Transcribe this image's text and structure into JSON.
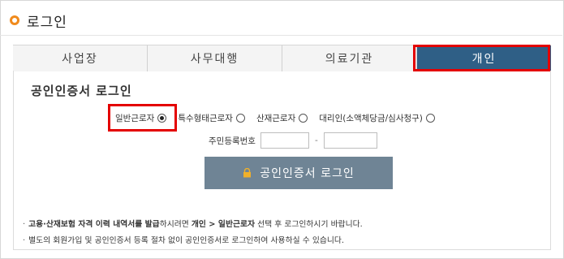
{
  "header": {
    "title": "로그인"
  },
  "tabs": [
    {
      "label": "사업장",
      "active": false
    },
    {
      "label": "사무대행",
      "active": false
    },
    {
      "label": "의료기관",
      "active": false
    },
    {
      "label": "개인",
      "active": true
    }
  ],
  "section": {
    "title": "공인인증서 로그인"
  },
  "radios": [
    {
      "label": "일반근로자",
      "checked": true
    },
    {
      "label": "특수형태근로자",
      "checked": false
    },
    {
      "label": "산재근로자",
      "checked": false
    },
    {
      "label": "대리인(소액체당금/심사청구)",
      "checked": false
    }
  ],
  "id_field": {
    "label": "주민등록번호",
    "first_value": "",
    "second_value": "",
    "separator": "-"
  },
  "login_button": {
    "label": "공인인증서 로그인",
    "icon": "lock-icon"
  },
  "notices": {
    "n1": {
      "bullet": "·",
      "bold1": "고용·산재보험 자격 이력 내역서를 발급",
      "text1": "하시려면 ",
      "bold2": "개인 > 일반근로자",
      "text2": " 선택 후 로그인하시기 바랍니다."
    },
    "n2": {
      "bullet": "·",
      "text": "별도의 회원가입 및 공인인증서 등록 절차 없이 공인인증서로 로그인하여 사용하실 수 있습니다."
    }
  },
  "colors": {
    "accent_orange": "#f08a1c",
    "active_tab": "#2f5f86",
    "login_button": "#6f8495",
    "highlight_red": "#e40000"
  }
}
